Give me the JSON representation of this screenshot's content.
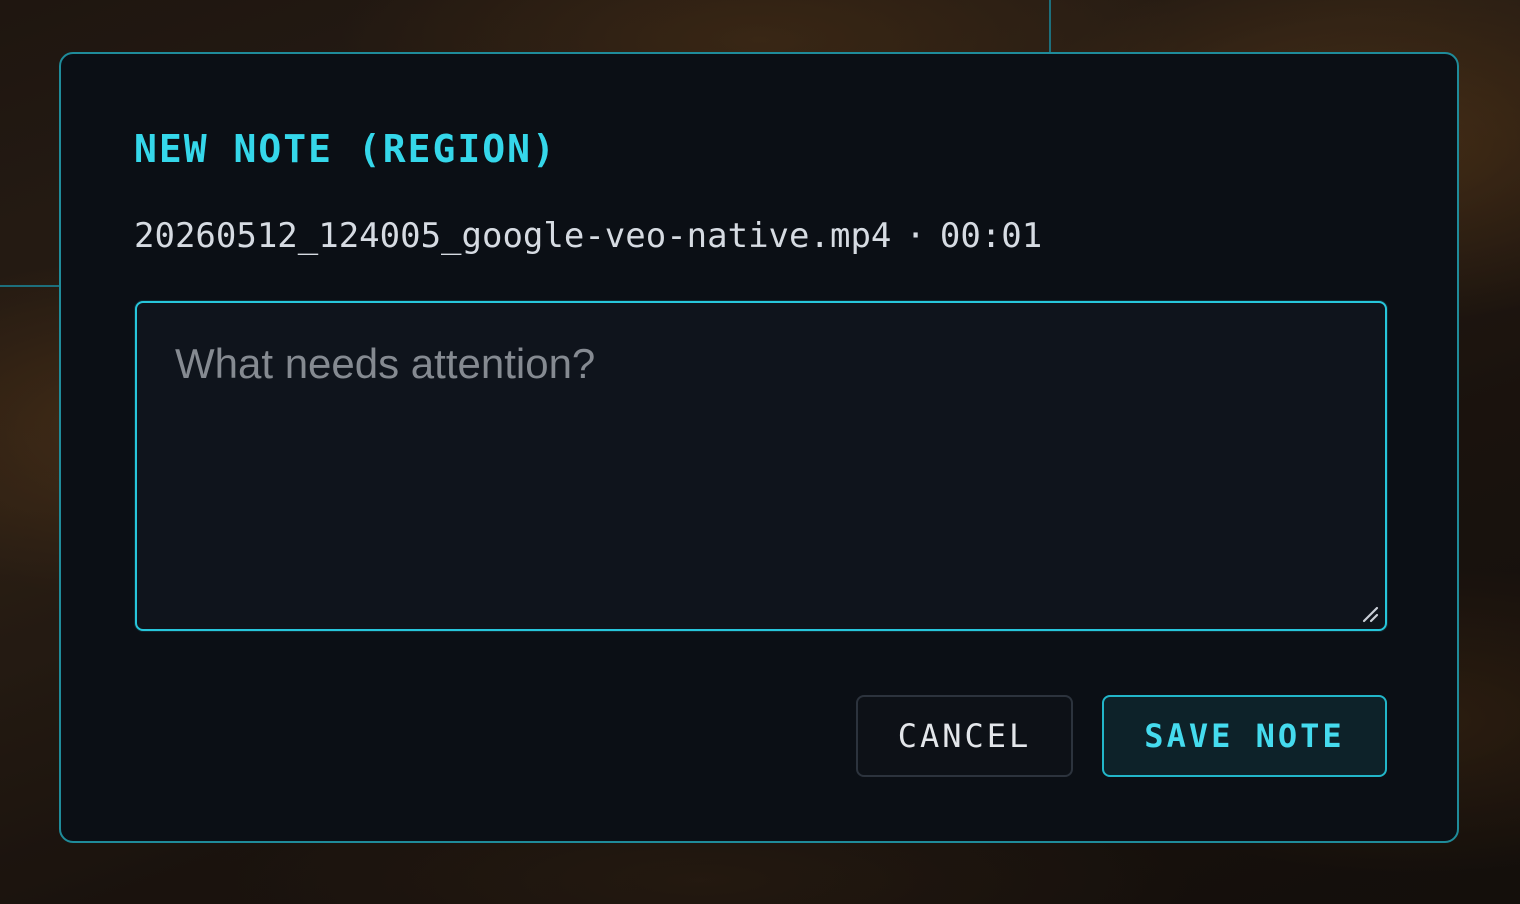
{
  "dialog": {
    "title": "NEW NOTE (REGION)",
    "filename": "20260512_124005_google-veo-native.mp4",
    "separator": "·",
    "timestamp": "00:01",
    "note_input": {
      "value": "",
      "placeholder": "What needs attention?"
    },
    "buttons": {
      "cancel_label": "CANCEL",
      "save_label": "SAVE NOTE"
    }
  },
  "colors": {
    "accent": "#35d7ea",
    "border": "#1f8b9a",
    "panel_bg": "#0b0f15"
  }
}
